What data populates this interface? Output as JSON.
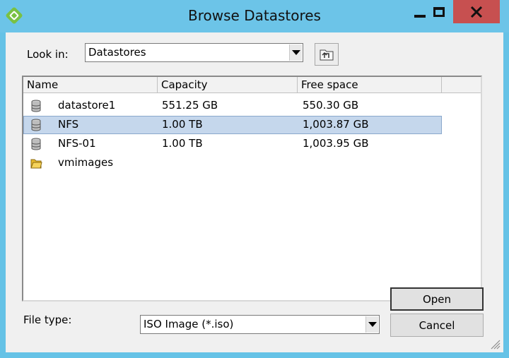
{
  "window": {
    "title": "Browse Datastores",
    "icon": "vsphere-client-icon",
    "controls": [
      "minimize-icon",
      "maximize-icon",
      "close-icon"
    ],
    "accent": "#65c2e6",
    "close_color": "#c75050"
  },
  "lookin": {
    "label": "Look in:",
    "value": "Datastores",
    "up_icon": "up-one-level-icon"
  },
  "list": {
    "columns": [
      "Name",
      "Capacity",
      "Free space"
    ],
    "rows": [
      {
        "name": "datastore1",
        "capacity": "551.25 GB",
        "free": "550.30 GB",
        "icon": "datastore-icon",
        "selected": false
      },
      {
        "name": "NFS",
        "capacity": "1.00 TB",
        "free": "1,003.87 GB",
        "icon": "datastore-icon",
        "selected": true
      },
      {
        "name": "NFS-01",
        "capacity": "1.00 TB",
        "free": "1,003.95 GB",
        "icon": "datastore-icon",
        "selected": false
      },
      {
        "name": "vmimages",
        "capacity": "",
        "free": "",
        "icon": "folder-icon",
        "selected": false
      }
    ],
    "selection_color": "#c5d7ec"
  },
  "filetype": {
    "label": "File type:",
    "value": "ISO Image (*.iso)"
  },
  "buttons": {
    "open": "Open",
    "cancel": "Cancel"
  }
}
